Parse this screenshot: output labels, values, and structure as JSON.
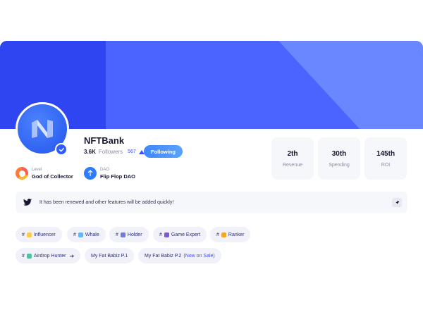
{
  "colors": {
    "cover_primary": "#3045f2",
    "cover_light": "#6b87ff",
    "accent": "#3d4cff",
    "follow_button": "#4a92ff"
  },
  "profile": {
    "name": "NFTBank",
    "avatar_icon": "nftbank-logo-icon",
    "verified_icon": "verified-check-icon",
    "followers_count": "3.6K",
    "followers_label": "Followers",
    "followers_delta": "567",
    "follow_button_label": "Following"
  },
  "meta": {
    "level_label": "Level",
    "level_value": "God of Collector",
    "dao_label": "DAO",
    "dao_value": "Flip Flop DAO"
  },
  "stats": [
    {
      "value": "2th",
      "label": "Revenue"
    },
    {
      "value": "30th",
      "label": "Spending"
    },
    {
      "value": "145th",
      "label": "ROI"
    }
  ],
  "tweet": {
    "icon": "twitter-icon",
    "text": "It has been renewed and other features will be added quickly!",
    "action_icon": "pin-icon"
  },
  "tags": [
    {
      "hash": "#",
      "label": "Influencer"
    },
    {
      "hash": "#",
      "label": "Whale"
    },
    {
      "hash": "#",
      "label": "Holder"
    },
    {
      "hash": "#",
      "label": "Game Expert"
    },
    {
      "hash": "#",
      "label": "Ranker"
    },
    {
      "hash": "#",
      "label": "Airdrop Hunter"
    }
  ],
  "projects": [
    {
      "label": "My Fat Babiz P.1"
    },
    {
      "label": "My Fat Babiz P.2",
      "badge": "(Now on Sale)"
    }
  ]
}
